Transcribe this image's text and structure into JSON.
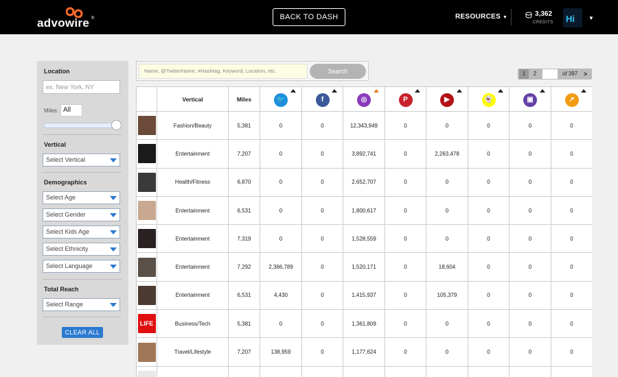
{
  "header": {
    "logo_text": "advowire",
    "back_button": "BACK TO DASH",
    "resources": "RESOURCES",
    "credits_value": "3,362",
    "credits_label": "CREDITS",
    "avatar_text": "Hi",
    "colors": {
      "bar": "#000000",
      "logo_accent": "#ff6a2a"
    }
  },
  "sidebar": {
    "location_heading": "Location",
    "location_placeholder": "ex. New York, NY",
    "miles_label": "Miles:",
    "miles_value": "All",
    "vertical_heading": "Vertical",
    "vertical_select": "Select Vertical",
    "demographics_heading": "Demographics",
    "age_select": "Select Age",
    "gender_select": "Select Gender",
    "kids_select": "Select Kids Age",
    "ethnicity_select": "Select Ethnicity",
    "language_select": "Select Language",
    "reach_heading": "Total Reach",
    "range_select": "Select Range",
    "clear_button": "CLEAR ALL"
  },
  "search": {
    "placeholder": "Name, @TwitterName, #Hashtag, Keyword, Location, etc.",
    "button": "Search"
  },
  "pager": {
    "page1": "1",
    "page2": "2",
    "of_text": "of 397",
    "next": ">"
  },
  "table": {
    "headers": {
      "vertical": "Vertical",
      "miles": "Miles"
    },
    "social_icons": [
      {
        "name": "twitter-icon",
        "color": "#1d8fe0",
        "glyph": "🐦"
      },
      {
        "name": "facebook-icon",
        "color": "#3b5998",
        "glyph": "f"
      },
      {
        "name": "instagram-icon",
        "color": "#8a3ab9",
        "glyph": "◎"
      },
      {
        "name": "pinterest-icon",
        "color": "#c8232c",
        "glyph": "P"
      },
      {
        "name": "youtube-icon",
        "color": "#b31217",
        "glyph": "▶"
      },
      {
        "name": "snapchat-icon",
        "color": "#fffc00",
        "glyph": "👻"
      },
      {
        "name": "twitch-icon",
        "color": "#6441a5",
        "glyph": "▣"
      },
      {
        "name": "analytics-icon",
        "color": "#f39c12",
        "glyph": "↗"
      }
    ],
    "rows": [
      {
        "vertical": "Fashion/Beauty",
        "miles": "5,381",
        "twitter": "0",
        "facebook": "0",
        "instagram": "12,343,949",
        "pinterest": "0",
        "youtube": "0",
        "snapchat": "0",
        "twitch": "0",
        "analytics": "0",
        "thumb": "#6b4a3a"
      },
      {
        "vertical": "Entertainment",
        "miles": "7,207",
        "twitter": "0",
        "facebook": "0",
        "instagram": "3,892,741",
        "pinterest": "0",
        "youtube": "2,263,478",
        "snapchat": "0",
        "twitch": "0",
        "analytics": "0",
        "thumb": "#1a1a1a"
      },
      {
        "vertical": "Health/Fitness",
        "miles": "6,870",
        "twitter": "0",
        "facebook": "0",
        "instagram": "2,652,707",
        "pinterest": "0",
        "youtube": "0",
        "snapchat": "0",
        "twitch": "0",
        "analytics": "0",
        "thumb": "#3a3a3a"
      },
      {
        "vertical": "Entertainment",
        "miles": "6,531",
        "twitter": "0",
        "facebook": "0",
        "instagram": "1,800,617",
        "pinterest": "0",
        "youtube": "0",
        "snapchat": "0",
        "twitch": "0",
        "analytics": "0",
        "thumb": "#c8a890"
      },
      {
        "vertical": "Entertainment",
        "miles": "7,319",
        "twitter": "0",
        "facebook": "0",
        "instagram": "1,528,559",
        "pinterest": "0",
        "youtube": "0",
        "snapchat": "0",
        "twitch": "0",
        "analytics": "0",
        "thumb": "#2a2222"
      },
      {
        "vertical": "Entertainment",
        "miles": "7,292",
        "twitter": "2,366,789",
        "facebook": "0",
        "instagram": "1,520,171",
        "pinterest": "0",
        "youtube": "18,604",
        "snapchat": "0",
        "twitch": "0",
        "analytics": "0",
        "thumb": "#5a5048"
      },
      {
        "vertical": "Entertainment",
        "miles": "6,531",
        "twitter": "4,430",
        "facebook": "0",
        "instagram": "1,415,937",
        "pinterest": "0",
        "youtube": "105,379",
        "snapchat": "0",
        "twitch": "0",
        "analytics": "0",
        "thumb": "#4a3a30"
      },
      {
        "vertical": "Business/Tech",
        "miles": "5,381",
        "twitter": "0",
        "facebook": "0",
        "instagram": "1,361,809",
        "pinterest": "0",
        "youtube": "0",
        "snapchat": "0",
        "twitch": "0",
        "analytics": "0",
        "thumb": "#e01010",
        "thumb_text": "LIFE"
      },
      {
        "vertical": "Travel/Lifestyle",
        "miles": "7,207",
        "twitter": "138,959",
        "facebook": "0",
        "instagram": "1,177,624",
        "pinterest": "0",
        "youtube": "0",
        "snapchat": "0",
        "twitch": "0",
        "analytics": "0",
        "thumb": "#a07858"
      },
      {
        "vertical": "",
        "miles": "",
        "twitter": "",
        "facebook": "",
        "instagram": "",
        "pinterest": "",
        "youtube": "",
        "snapchat": "",
        "twitch": "",
        "analytics": "",
        "thumb": "#e8e8e8"
      }
    ]
  }
}
